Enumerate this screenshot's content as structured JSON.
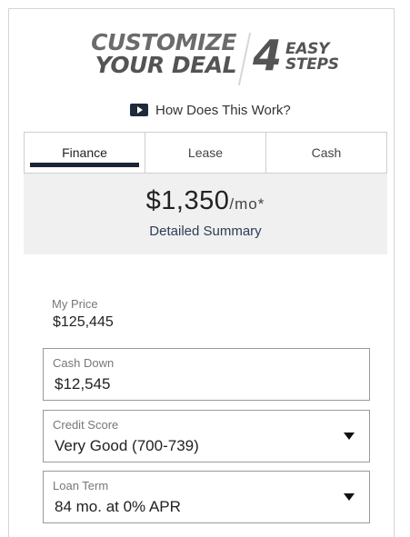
{
  "header": {
    "logo_line1": "CUSTOMIZE",
    "logo_line2": "YOUR DEAL",
    "logo_number": "4",
    "logo_word1": "EASY",
    "logo_word2": "STEPS"
  },
  "how_link": {
    "label": "How Does This Work?",
    "icon": "play-icon"
  },
  "tabs": [
    {
      "label": "Finance",
      "active": true
    },
    {
      "label": "Lease",
      "active": false
    },
    {
      "label": "Cash",
      "active": false
    }
  ],
  "summary": {
    "amount": "$1,350",
    "unit": "/mo*",
    "link": "Detailed Summary"
  },
  "my_price": {
    "label": "My Price",
    "value": "$125,445"
  },
  "cash_down": {
    "label": "Cash Down",
    "value": "$12,545"
  },
  "credit_score": {
    "label": "Credit Score",
    "value": "Very Good (700-739)"
  },
  "loan_term": {
    "label": "Loan Term",
    "value": "84 mo. at 0% APR"
  },
  "colors": {
    "accent": "#1c2533",
    "summary_bg": "#f0f0f0",
    "border": "#cfcfcf"
  }
}
